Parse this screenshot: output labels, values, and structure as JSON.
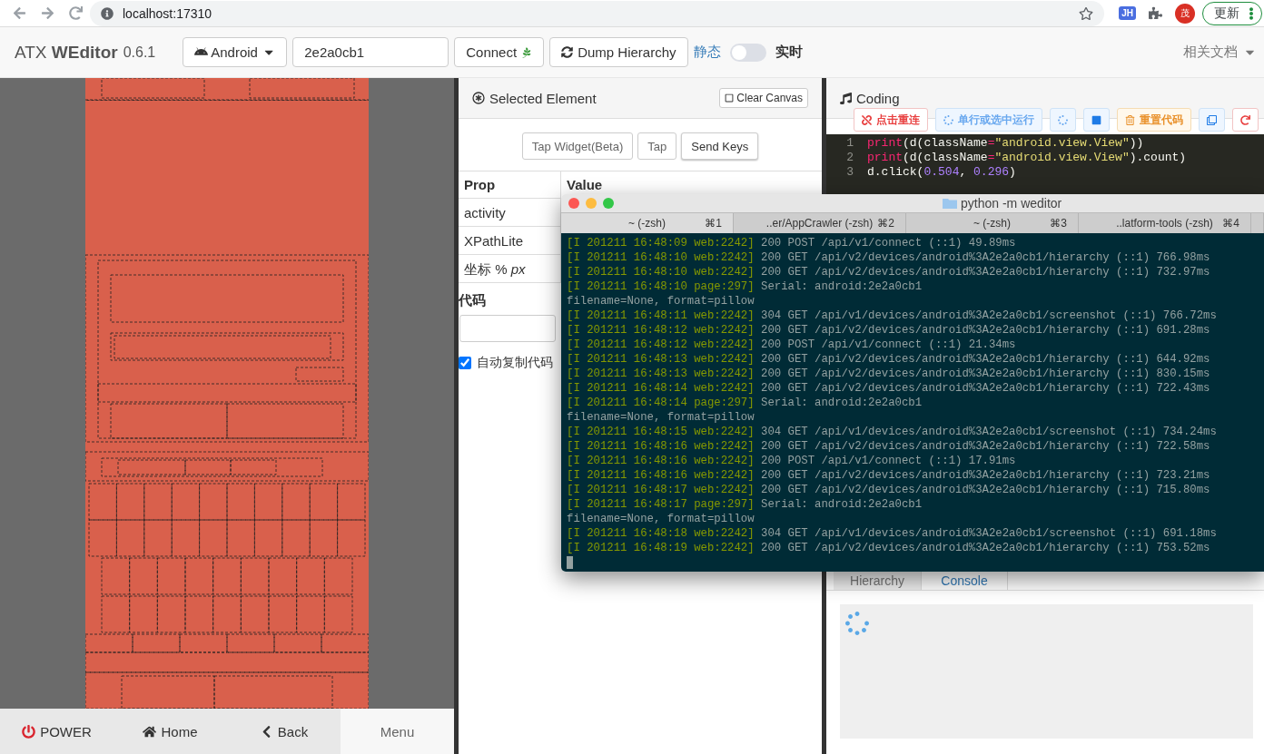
{
  "browser": {
    "url": "localhost:17310",
    "extension_badge": "JH",
    "avatar": "茂",
    "update_button": "更新"
  },
  "navbar": {
    "brand": "ATX **WEditor**",
    "version": "0.6.1",
    "platform": "Android",
    "serial": "2e2a0cb1",
    "connect": "Connect",
    "dump": "Dump Hierarchy",
    "mode_off_label": "静态",
    "mode_on_label": "实时",
    "realtime_on": false,
    "docs": "相关文档"
  },
  "device": {
    "buttons": [
      {
        "label": "POWER",
        "kind": "key"
      },
      {
        "label": "Home",
        "kind": "key"
      },
      {
        "label": "Back",
        "kind": "key"
      },
      {
        "label": "Menu",
        "kind": "plain"
      }
    ]
  },
  "selected_panel": {
    "title": "Selected Element",
    "clear_button": "Clear Canvas",
    "actions": [
      {
        "label": "Tap Widget(Beta)",
        "primary": false
      },
      {
        "label": "Tap",
        "primary": false
      },
      {
        "label": "Send Keys",
        "primary": true
      }
    ],
    "columns": [
      "Prop",
      "Value"
    ],
    "rows": [
      "activity",
      "XPathLite",
      "坐标 % *px*"
    ],
    "code_heading": "代码",
    "auto_copy": {
      "label": "自动复制代码",
      "checked": true
    }
  },
  "coding_panel": {
    "title": "Coding",
    "toolbar": [
      {
        "label": "点击重连",
        "kind": "danger"
      },
      {
        "label": "单行或选中运行",
        "kind": "info"
      },
      {
        "kind": "info"
      },
      {
        "kind": "primary"
      },
      {
        "label": "重置代码",
        "kind": "warning"
      },
      {
        "kind": "primary"
      },
      {
        "kind": "danger"
      }
    ],
    "code": [
      {
        "num": "1",
        "tokens": [
          {
            "t": "print",
            "kind": "fn"
          },
          {
            "t": "(d(className",
            "kind": "plain"
          },
          {
            "t": "=",
            "kind": "op"
          },
          {
            "t": "\"android.view.View\"",
            "kind": "str"
          },
          {
            "t": "))",
            "kind": "plain"
          }
        ]
      },
      {
        "num": "2",
        "tokens": [
          {
            "t": "print",
            "kind": "fn"
          },
          {
            "t": "(d(className",
            "kind": "plain"
          },
          {
            "t": "=",
            "kind": "op"
          },
          {
            "t": "\"android.view.View\"",
            "kind": "str"
          },
          {
            "t": ").count)",
            "kind": "plain"
          }
        ]
      },
      {
        "num": "3",
        "tokens": [
          {
            "t": "d.click(",
            "kind": "plain"
          },
          {
            "t": "0.504",
            "kind": "num"
          },
          {
            "t": ", ",
            "kind": "plain"
          },
          {
            "t": "0.296",
            "kind": "num"
          },
          {
            "t": ")",
            "kind": "plain"
          }
        ]
      }
    ],
    "tabs": [
      {
        "label": "Hierarchy",
        "selected": false
      },
      {
        "label": "Console",
        "selected": true
      }
    ]
  },
  "terminal": {
    "title": "python -m weditor",
    "tabs": [
      {
        "label": "~ (-zsh)",
        "shortcut": "⌘1",
        "selected": true
      },
      {
        "label": "..er/AppCrawler (-zsh)",
        "shortcut": "⌘2",
        "selected": false
      },
      {
        "label": "~ (-zsh)",
        "shortcut": "⌘3",
        "selected": false
      },
      {
        "label": "..latform-tools (-zsh)",
        "shortcut": "⌘4",
        "selected": false
      }
    ],
    "lines": [
      {
        "tag": "[I 201211 16:48:09 web:2242]",
        "text": "200 POST /api/v1/connect (::1) 49.89ms"
      },
      {
        "tag": "[I 201211 16:48:10 web:2242]",
        "text": "200 GET /api/v2/devices/android%3A2e2a0cb1/hierarchy (::1) 766.98ms"
      },
      {
        "tag": "[I 201211 16:48:10 web:2242]",
        "text": "200 GET /api/v2/devices/android%3A2e2a0cb1/hierarchy (::1) 732.97ms"
      },
      {
        "tag": "[I 201211 16:48:10 page:297]",
        "text": "Serial: android:2e2a0cb1"
      },
      {
        "text": "filename=None, format=pillow"
      },
      {
        "tag": "[I 201211 16:48:11 web:2242]",
        "text": "304 GET /api/v1/devices/android%3A2e2a0cb1/screenshot (::1) 766.72ms"
      },
      {
        "tag": "[I 201211 16:48:12 web:2242]",
        "text": "200 GET /api/v2/devices/android%3A2e2a0cb1/hierarchy (::1) 691.28ms"
      },
      {
        "tag": "[I 201211 16:48:12 web:2242]",
        "text": "200 POST /api/v1/connect (::1) 21.34ms"
      },
      {
        "tag": "[I 201211 16:48:13 web:2242]",
        "text": "200 GET /api/v2/devices/android%3A2e2a0cb1/hierarchy (::1) 644.92ms"
      },
      {
        "tag": "[I 201211 16:48:13 web:2242]",
        "text": "200 GET /api/v2/devices/android%3A2e2a0cb1/hierarchy (::1) 830.15ms"
      },
      {
        "tag": "[I 201211 16:48:14 web:2242]",
        "text": "200 GET /api/v2/devices/android%3A2e2a0cb1/hierarchy (::1) 722.43ms"
      },
      {
        "tag": "[I 201211 16:48:14 page:297]",
        "text": "Serial: android:2e2a0cb1"
      },
      {
        "text": "filename=None, format=pillow"
      },
      {
        "tag": "[I 201211 16:48:15 web:2242]",
        "text": "304 GET /api/v1/devices/android%3A2e2a0cb1/screenshot (::1) 734.24ms"
      },
      {
        "tag": "[I 201211 16:48:16 web:2242]",
        "text": "200 GET /api/v2/devices/android%3A2e2a0cb1/hierarchy (::1) 722.58ms"
      },
      {
        "tag": "[I 201211 16:48:16 web:2242]",
        "text": "200 POST /api/v1/connect (::1) 17.91ms"
      },
      {
        "tag": "[I 201211 16:48:16 web:2242]",
        "text": "200 GET /api/v2/devices/android%3A2e2a0cb1/hierarchy (::1) 723.21ms"
      },
      {
        "tag": "[I 201211 16:48:17 web:2242]",
        "text": "200 GET /api/v2/devices/android%3A2e2a0cb1/hierarchy (::1) 715.80ms"
      },
      {
        "tag": "[I 201211 16:48:17 page:297]",
        "text": "Serial: android:2e2a0cb1"
      },
      {
        "text": "filename=None, format=pillow"
      },
      {
        "tag": "[I 201211 16:48:18 web:2242]",
        "text": "304 GET /api/v1/devices/android%3A2e2a0cb1/screenshot (::1) 691.18ms"
      },
      {
        "tag": "[I 201211 16:48:19 web:2242]",
        "text": "200 GET /api/v2/devices/android%3A2e2a0cb1/hierarchy (::1) 753.52ms"
      }
    ]
  }
}
